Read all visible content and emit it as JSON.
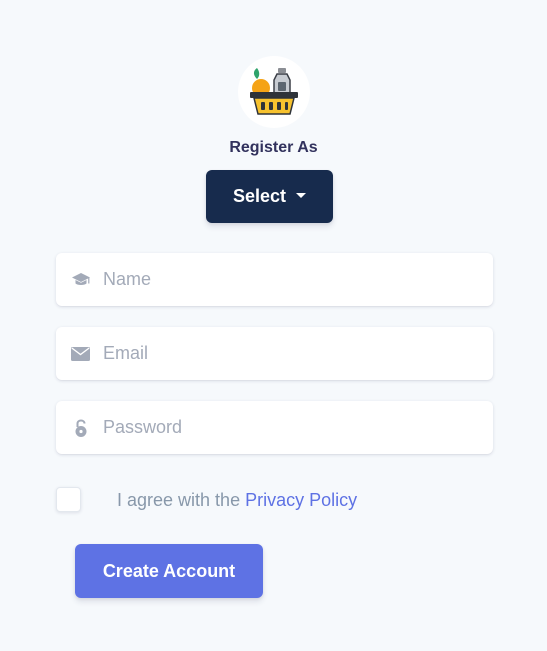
{
  "header": {
    "logo_icon": "grocery-basket-icon",
    "register_label": "Register As"
  },
  "role_select": {
    "label": "Select",
    "icon": "caret-down-icon"
  },
  "form": {
    "name": {
      "placeholder": "Name",
      "value": "",
      "icon": "graduation-cap-icon"
    },
    "email": {
      "placeholder": "Email",
      "value": "",
      "icon": "envelope-icon"
    },
    "password": {
      "placeholder": "Password",
      "value": "",
      "icon": "lock-open-icon"
    }
  },
  "agreement": {
    "checked": false,
    "text": "I agree with the",
    "link_text": "Privacy Policy"
  },
  "submit": {
    "label": "Create Account"
  },
  "colors": {
    "background": "#f6f9fc",
    "select_button": "#172b4d",
    "primary": "#5e72e4",
    "icon_gray": "#a3aab8"
  }
}
